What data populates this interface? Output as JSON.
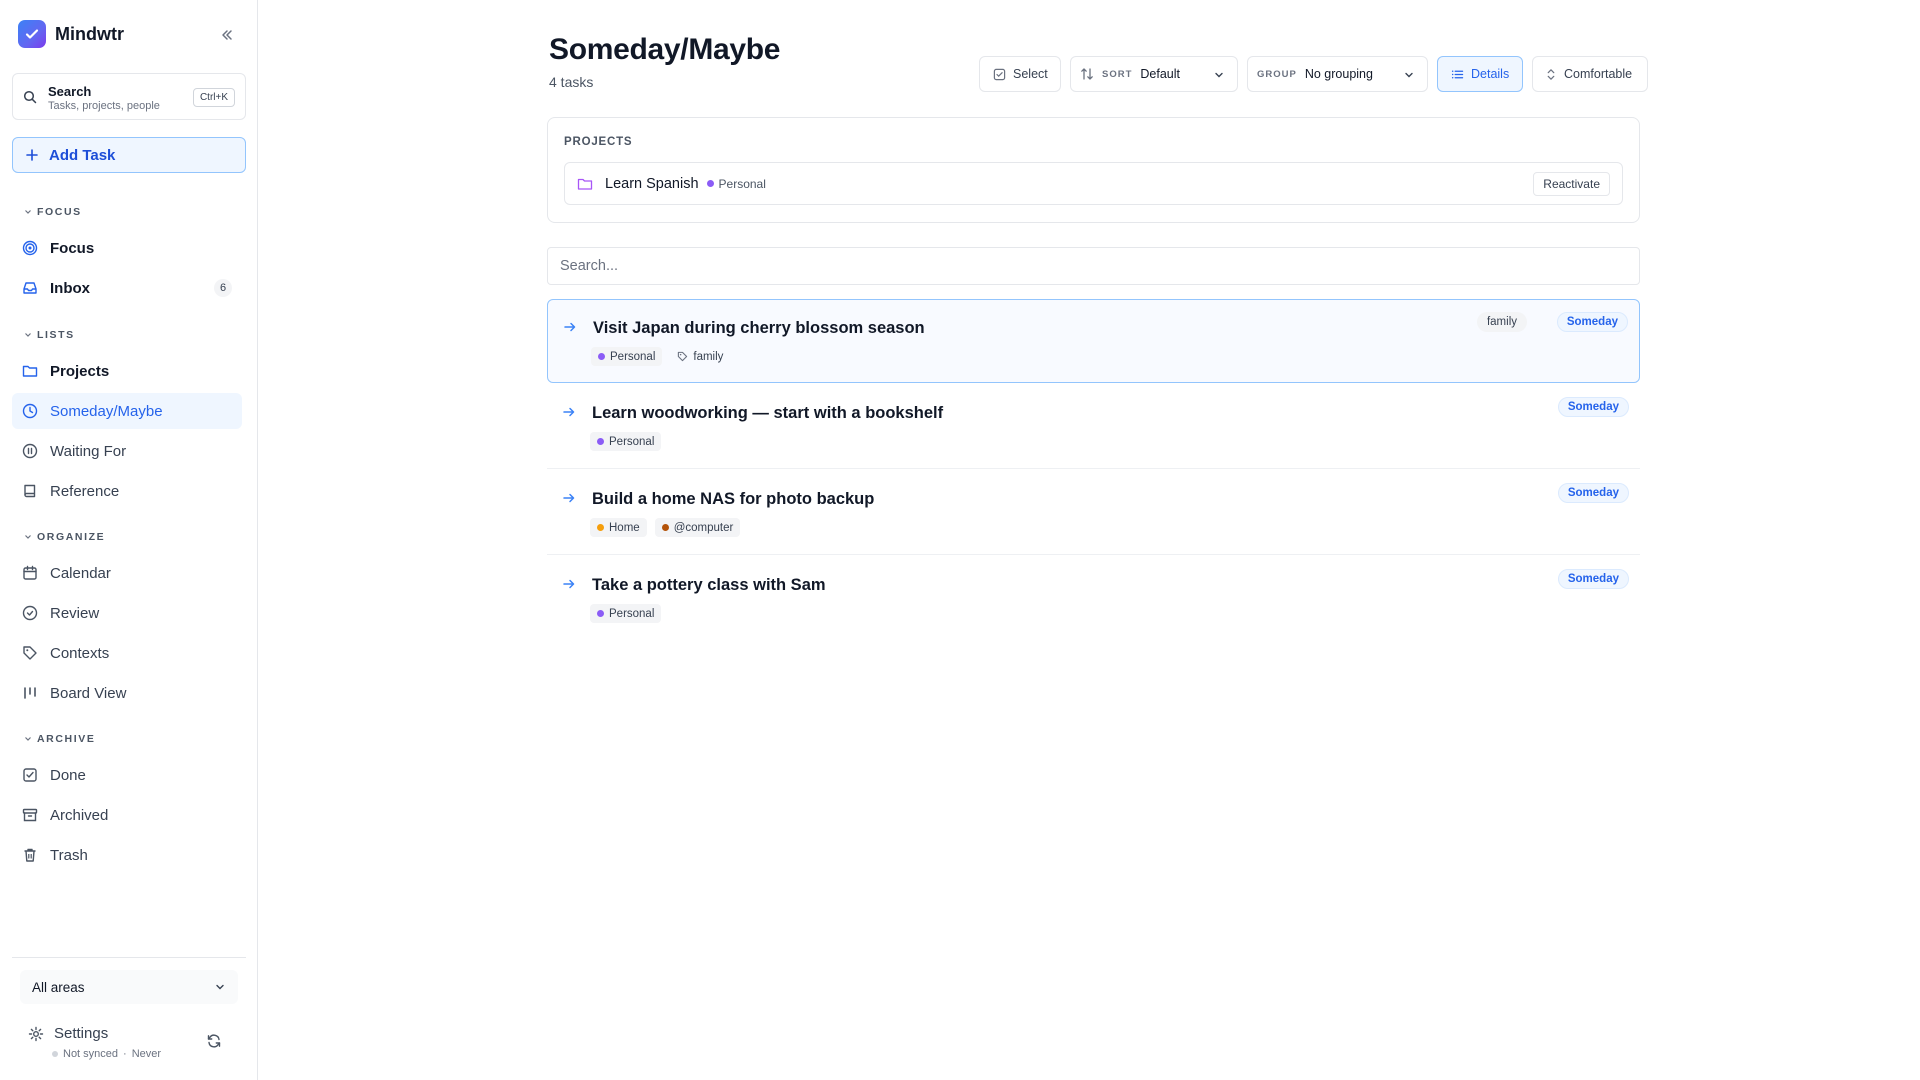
{
  "app": {
    "name": "Mindwtr",
    "search_title": "Search",
    "search_subtitle": "Tasks, projects, people",
    "search_shortcut": "Ctrl+K",
    "add_task_label": "Add Task"
  },
  "sidebar": {
    "sections": {
      "focus": "FOCUS",
      "lists": "LISTS",
      "organize": "ORGANIZE",
      "archive": "ARCHIVE"
    },
    "items": {
      "focus": "Focus",
      "inbox": "Inbox",
      "inbox_count": "6",
      "projects": "Projects",
      "someday": "Someday/Maybe",
      "waiting": "Waiting For",
      "reference": "Reference",
      "calendar": "Calendar",
      "review": "Review",
      "contexts": "Contexts",
      "board": "Board View",
      "done": "Done",
      "archived": "Archived",
      "trash": "Trash"
    },
    "areas_select": "All areas",
    "settings_label": "Settings",
    "sync_status": "Not synced",
    "sync_sep": "·",
    "sync_time": "Never"
  },
  "main": {
    "title": "Someday/Maybe",
    "task_count": "4 tasks",
    "toolbar": {
      "select_label": "Select",
      "sort_caption": "SORT",
      "sort_value": "Default",
      "group_caption": "GROUP",
      "group_value": "No grouping",
      "details_label": "Details",
      "density_label": "Comfortable"
    },
    "projects": {
      "label": "PROJECTS",
      "project_name": "Learn Spanish",
      "project_area": "Personal",
      "reactivate_label": "Reactivate"
    },
    "search_placeholder": "Search...",
    "tasks": [
      {
        "title": "Visit Japan during cherry blossom season",
        "area": "Personal",
        "tag": "family",
        "tag_pill": "family",
        "status": "Someday"
      },
      {
        "title": "Learn woodworking — start with a bookshelf",
        "area": "Personal",
        "status": "Someday"
      },
      {
        "title": "Build a home NAS for photo backup",
        "area": "Home",
        "context": "@computer",
        "status": "Someday"
      },
      {
        "title": "Take a pottery class with Sam",
        "area": "Personal",
        "status": "Someday"
      }
    ]
  },
  "colors": {
    "accent": "#2563eb",
    "personal_area": "#8b5cf6",
    "home_area": "#f59e0b",
    "computer_context": "#b45309",
    "project_folder": "#a855f7"
  }
}
